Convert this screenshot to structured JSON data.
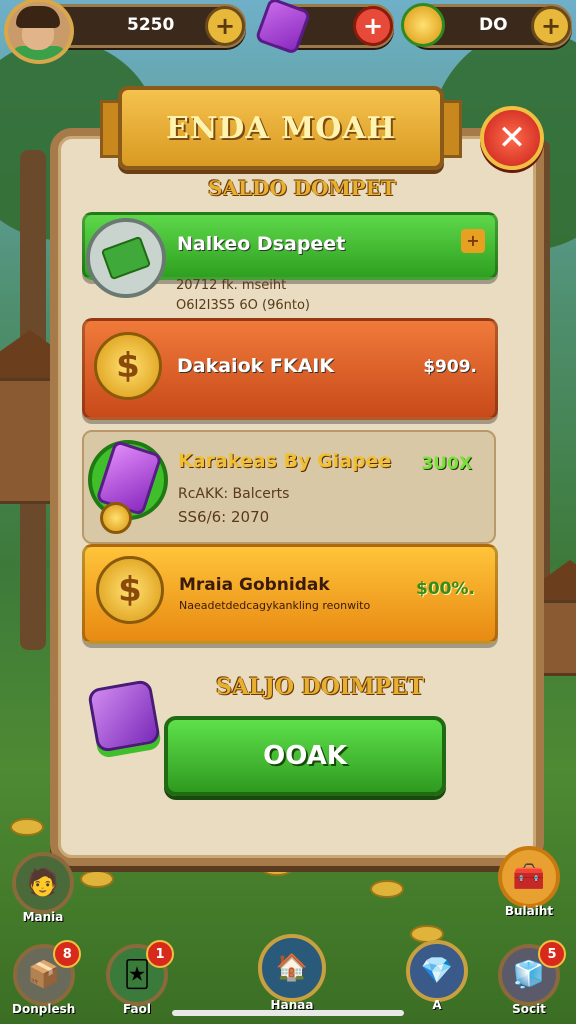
{
  "hud": {
    "coins_value": "5250",
    "gems_plus": "+",
    "coins_plus": "+",
    "currency_value": "DO",
    "currency_plus": "+"
  },
  "panel": {
    "title": "ENDA MOAH",
    "close_label": "✕",
    "section1_title": "SALDO DOMPET",
    "section2_title": "SALJO DOIMPET"
  },
  "rows": [
    {
      "label": "Nalkeo Dsapeet",
      "value": "+",
      "sub1": "20712 fk. mseiht",
      "sub2": "O6I2I3S5 6O (96nto)"
    },
    {
      "label": "Dakaiok FKAIK",
      "value": "$909."
    },
    {
      "label": "Karakeas By Giapee",
      "value": "3U0X",
      "sub1": "RcAKK: Balcerts",
      "sub2": "SS6/6: 2070"
    },
    {
      "label": "Mraia Gobnidak",
      "value": "$00%.",
      "sub1": "Naeadetdedcagykankling reonwito"
    }
  ],
  "confirm_label": "OOAK",
  "nav": [
    {
      "label": "Mania"
    },
    {
      "label": "Donplesh",
      "badge": "8"
    },
    {
      "label": "Faol",
      "badge": "1"
    },
    {
      "label": "Hanaa"
    },
    {
      "label": "A"
    },
    {
      "label": "Bulaiht"
    },
    {
      "label": "Socit",
      "badge": "5"
    }
  ],
  "colors": {
    "green_row": "#3fbf2a",
    "orange_row": "#e2612a",
    "gold_row": "#f2a71e",
    "panel_bg": "#e9dcc0"
  }
}
